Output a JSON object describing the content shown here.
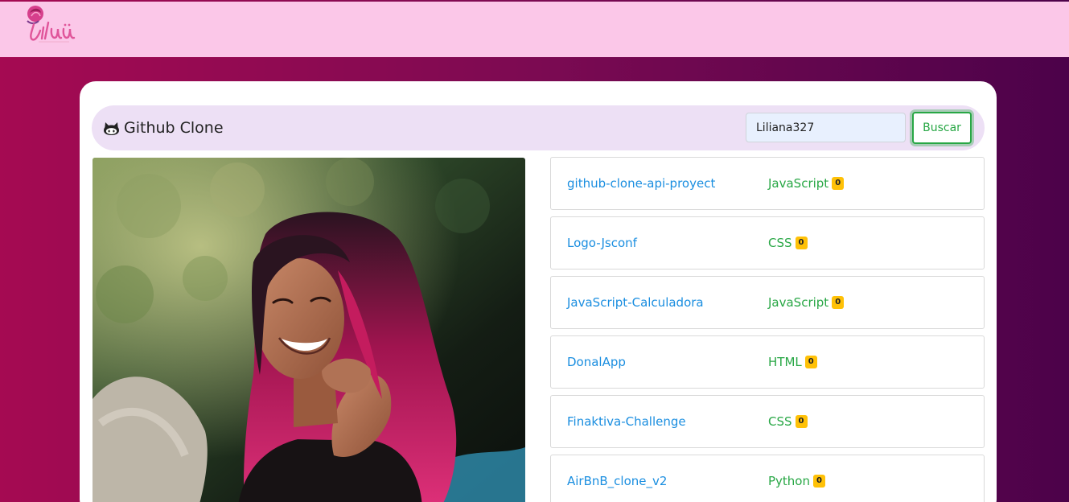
{
  "brand": {
    "title": "Github Clone",
    "icon": "github-icon"
  },
  "search": {
    "value": "Liliana327",
    "button_label": "Buscar"
  },
  "repos": [
    {
      "name": "github-clone-api-proyect",
      "language": "JavaScript",
      "stars": "0"
    },
    {
      "name": "Logo-Jsconf",
      "language": "CSS",
      "stars": "0"
    },
    {
      "name": "JavaScript-Calculadora",
      "language": "JavaScript",
      "stars": "0"
    },
    {
      "name": "DonalApp",
      "language": "HTML",
      "stars": "0"
    },
    {
      "name": "Finaktiva-Challenge",
      "language": "CSS",
      "stars": "0"
    },
    {
      "name": "AirBnB_clone_v2",
      "language": "Python",
      "stars": "0"
    }
  ],
  "colors": {
    "header_bg": "#fbc7e8",
    "gradient_start": "#a50a52",
    "gradient_end": "#4c024a",
    "link": "#1a8ee0",
    "language": "#28a745",
    "badge": "#ffc107"
  }
}
